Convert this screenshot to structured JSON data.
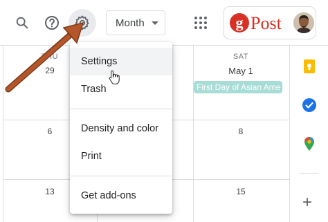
{
  "topbar": {
    "view_select": {
      "label": "Month"
    },
    "brand": {
      "letter": "g",
      "word": "Post"
    }
  },
  "calendar": {
    "columns": [
      {
        "day_name": "THU",
        "date": "29"
      },
      {
        "day_name": "SAT",
        "date": "May 1"
      }
    ],
    "rows": [
      {
        "thu": "6",
        "sat": "8"
      },
      {
        "thu": "13",
        "sat": "15"
      }
    ],
    "event": {
      "label": "First Day of Asian Ame",
      "color": "#a8dcd6"
    }
  },
  "settings_menu": {
    "items": [
      {
        "label": "Settings",
        "hovered": true
      },
      {
        "label": "Trash"
      },
      {
        "label": "Density and color"
      },
      {
        "label": "Print"
      },
      {
        "label": "Get add-ons"
      }
    ]
  },
  "side_panel": {
    "icons": [
      "keep-icon",
      "tasks-icon",
      "maps-icon",
      "add-icon"
    ],
    "add_label": "+"
  },
  "colors": {
    "arrow": "#a0522d",
    "brand_red": "#d93025",
    "event_bg": "#a8dcd6"
  }
}
